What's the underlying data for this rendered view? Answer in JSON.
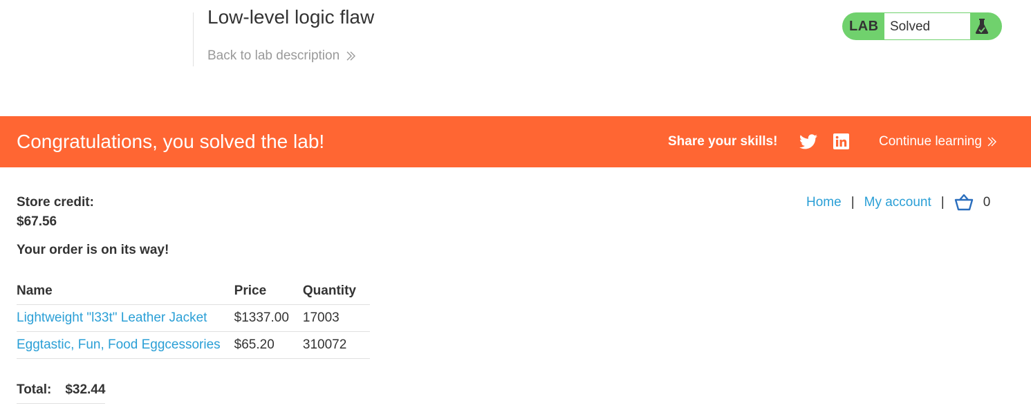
{
  "header": {
    "lab_title": "Low-level logic flaw",
    "back_link": "Back to lab description",
    "badge": {
      "label": "LAB",
      "status": "Solved",
      "icon": "flask-icon"
    }
  },
  "banner": {
    "message": "Congratulations, you solved the lab!",
    "share_label": "Share your skills!",
    "social_icons": [
      "twitter-icon",
      "linkedin-icon"
    ],
    "continue_link": "Continue learning",
    "color": "#ff6633"
  },
  "account": {
    "store_credit_label": "Store credit:",
    "store_credit_value": "$67.56",
    "order_message": "Your order is on its way!"
  },
  "nav": {
    "home": "Home",
    "separator": "|",
    "my_account": "My account",
    "cart_icon": "basket-icon",
    "cart_count": "0"
  },
  "order_table": {
    "headers": [
      "Name",
      "Price",
      "Quantity"
    ],
    "rows": [
      {
        "name": "Lightweight \"l33t\" Leather Jacket",
        "price": "$1337.00",
        "quantity": "17003"
      },
      {
        "name": "Eggtastic, Fun, Food Eggcessories",
        "price": "$65.20",
        "quantity": "310072"
      }
    ]
  },
  "total": {
    "label": "Total:",
    "value": "$32.44"
  },
  "colors": {
    "accent_link": "#2a9fd6",
    "solved_green": "#70d16d",
    "banner_orange": "#ff6633"
  }
}
